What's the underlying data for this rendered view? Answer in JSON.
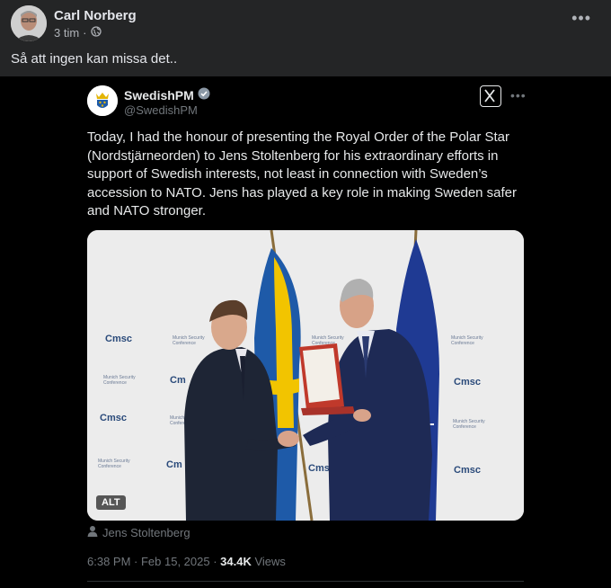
{
  "fb_post": {
    "author": "Carl Norberg",
    "time": "3 tim",
    "separator": "·",
    "text": "Så att ingen kan missa det..",
    "privacy_icon": "globe-icon",
    "more_icon": "more-horizontal-icon"
  },
  "tweet": {
    "name": "SwedishPM",
    "handle": "@SwedishPM",
    "verified_icon": "verified-badge-icon",
    "x_logo_icon": "x-logo-icon",
    "more_icon": "more-horizontal-icon",
    "text": "Today, I had the honour of presenting the Royal Order of the Polar Star (Nordstjärneorden) to Jens Stoltenberg for his extraordinary efforts in support of Swedish interests, not least in connection with Sweden’s accession to NATO. Jens has played a key role in making Sweden safer and NATO stronger.",
    "image": {
      "alt_badge": "ALT",
      "backdrop_text": [
        "msc",
        "Munich Security Conference"
      ]
    },
    "tagged_person": "Jens Stoltenberg",
    "timestamp": "6:38 PM · Feb 15, 2025 · ",
    "views_count": "34.4K",
    "views_label": "Views"
  },
  "colors": {
    "fb_background": "#242526",
    "tweet_background": "#000000",
    "text_primary": "#e7e9ea",
    "text_secondary": "#71767b",
    "verified": "#8b98a5",
    "flag_sweden_blue": "#1e5aa8",
    "flag_sweden_yellow": "#f2c400",
    "flag_nato_blue": "#1f3a93"
  }
}
